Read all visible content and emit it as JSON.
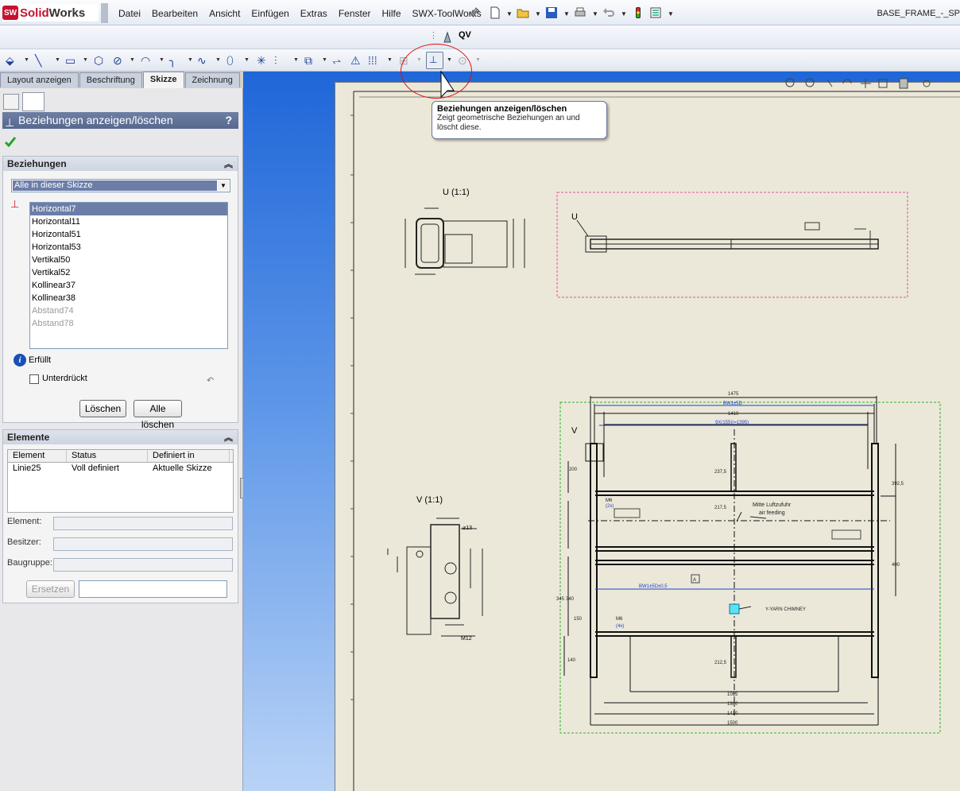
{
  "app": {
    "logo_brand": "Solid",
    "logo_brand2": "Works",
    "logo_badge": "SW",
    "window_title": "BASE_FRAME_-_SP"
  },
  "menu": [
    "Datei",
    "Bearbeiten",
    "Ansicht",
    "Einfügen",
    "Extras",
    "Fenster",
    "Hilfe",
    "SWX-ToolWorks"
  ],
  "qv_label": "QV",
  "tabs": [
    "Layout anzeigen",
    "Beschriftung",
    "Skizze",
    "Zeichnung"
  ],
  "active_tab": "Skizze",
  "pm": {
    "title": "Beziehungen anzeigen/löschen",
    "help": "?",
    "relations": {
      "title": "Beziehungen",
      "filter": "Alle in dieser Skizze",
      "items": [
        "Horizontal7",
        "Horizontal11",
        "Horizontal51",
        "Horizontal53",
        "Vertikal50",
        "Vertikal52",
        "Kollinear37",
        "Kollinear38",
        "Abstand74",
        "Abstand78"
      ],
      "status": "Erfüllt",
      "suppressed_label": "Unterdrückt",
      "delete_button": "Löschen",
      "delete_all_button": "Alle löschen"
    },
    "elements": {
      "title": "Elemente",
      "columns": [
        "Element",
        "Status",
        "Definiert in"
      ],
      "rows": [
        [
          "Linie25",
          "Voll definiert",
          "Aktuelle Skizze"
        ]
      ],
      "element_label": "Element:",
      "owner_label": "Besitzer:",
      "assembly_label": "Baugruppe:",
      "replace_button": "Ersetzen"
    }
  },
  "tooltip": {
    "title": "Beziehungen anzeigen/löschen",
    "body": "Zeigt geometrische Beziehungen an und löscht diese."
  },
  "drawing": {
    "view_u_label": "U (1:1)",
    "view_v_label": "V (1:1)",
    "u_marker": "U",
    "v_marker": "V",
    "dims": {
      "d1475": "1475",
      "d1410": "1410",
      "bw1": "BW1±5D",
      "d9x": "9X(155)(=1395)",
      "d200": "200",
      "d237": "237,5",
      "d217": "217,5",
      "d392": "392,5",
      "d400": "400",
      "d150": "150",
      "d345": "345",
      "d340": "340",
      "bw2": "BW1±5D±0,5",
      "d1085": "1085",
      "d1360": "1360",
      "d1410b": "1410",
      "d1500": "1500",
      "d140": "140",
      "d212": "212,5"
    },
    "note_air": "Mitte Luftzufuhr",
    "note_air2": "air feeding",
    "note_chimney": "Y-YARN CHIMNEY",
    "datum_a": "A",
    "m6_1": "M6",
    "m6_2": "M6",
    "m12": "M12",
    "pcs": "(2x)",
    "pcs2": "(4x)"
  },
  "colors": {
    "accent": "#1b3f99",
    "viewport_top": "#1f66d8",
    "sheet": "#ece8d9",
    "highlight": "#6c7ea8"
  }
}
